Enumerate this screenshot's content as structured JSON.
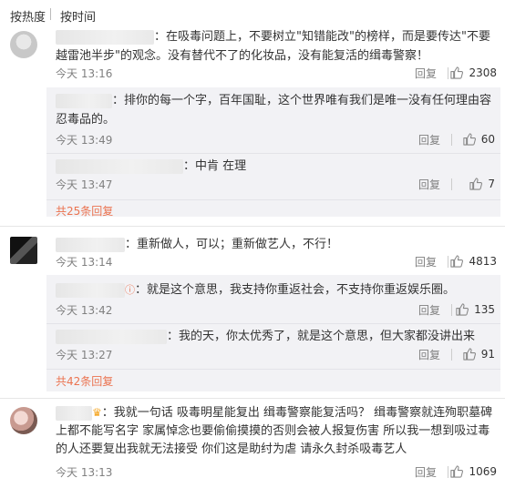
{
  "sort": {
    "hot": "按热度",
    "time": "按时间"
  },
  "comments": [
    {
      "text": "：在吸毒问题上，不要树立\"知错能改\"的榜样，而是要传达\"不要越雷池半步\"的观念。没有替代不了的化妆品，没有能复活的缉毒警察！",
      "time": "今天 13:16",
      "reply": "回复",
      "likes": "2308",
      "subs": [
        {
          "text": "：排你的每一个字，百年国耻，这个世界唯有我们是唯一没有任何理由容忍毒品的。",
          "time": "今天 13:49",
          "reply": "回复",
          "likes": "60"
        },
        {
          "text": "：中肯 在理",
          "time": "今天 13:47",
          "reply": "回复",
          "likes": "7"
        }
      ],
      "more": "共25条回复"
    },
    {
      "text": "：重新做人，可以；重新做艺人，不行！",
      "time": "今天 13:14",
      "reply": "回复",
      "likes": "4813",
      "subs": [
        {
          "text": "：就是这个意思，我支持你重返社会，不支持你重返娱乐圈。",
          "time": "今天 13:42",
          "reply": "回复",
          "likes": "135"
        },
        {
          "text": "：我的天，你太优秀了，就是这个意思，但大家都没讲出来",
          "time": "今天 13:27",
          "reply": "回复",
          "likes": "91"
        }
      ],
      "more": "共42条回复"
    },
    {
      "text": "：我就一句话 吸毒明星能复出 缉毒警察能复活吗？ 缉毒警察就连殉职墓碑上都不能写名字 家属悼念也要偷偷摸摸的否则会被人报复伤害 所以我一想到吸过毒的人还要复出我就无法接受 你们这是助纣为虐 请永久封杀吸毒艺人",
      "time": "今天 13:13",
      "reply": "回复",
      "likes": "1069"
    }
  ],
  "colors": {
    "link": "#eb7350",
    "meta": "#808080",
    "subbg": "#f2f2f5"
  },
  "icons": {
    "like": "thumbs-up-icon"
  }
}
